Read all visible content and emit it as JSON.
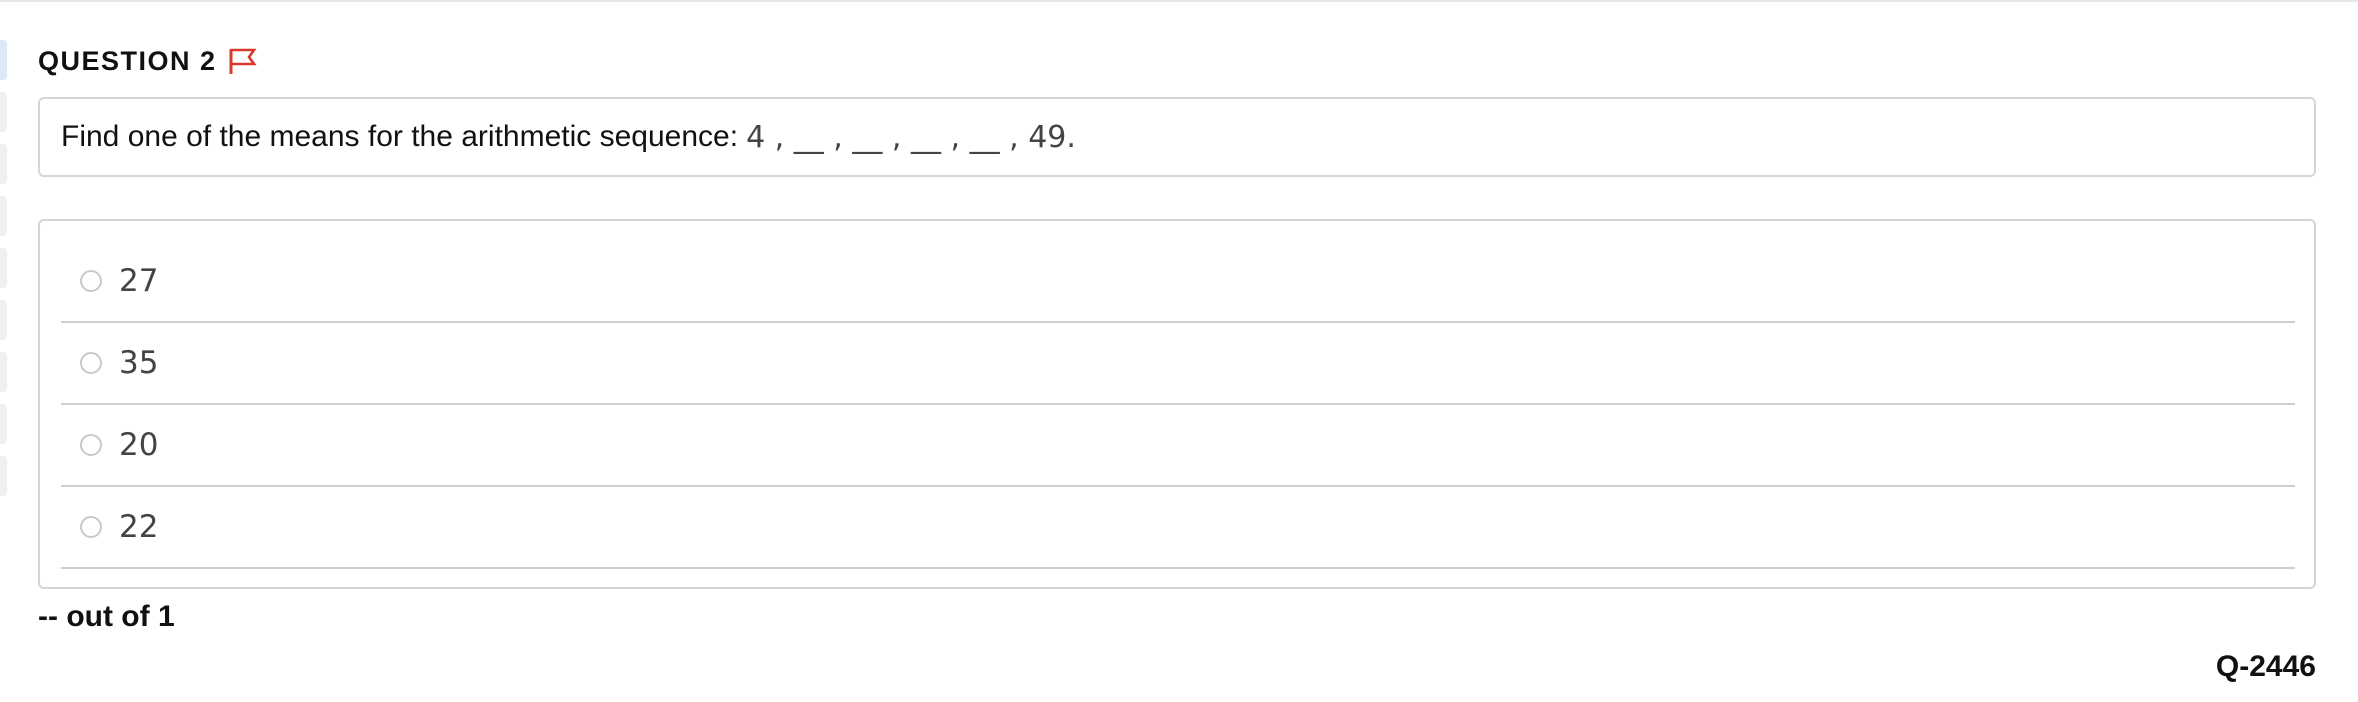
{
  "question": {
    "title": "QUESTION 2",
    "flag_icon": "flag-icon",
    "flag_color": "#d9382c",
    "prompt_text": "Find one of the means for the arithmetic sequence:",
    "prompt_math": "4 , __ , __ , __ , __ , 49."
  },
  "options": [
    {
      "label": "27",
      "selected": false
    },
    {
      "label": "35",
      "selected": false
    },
    {
      "label": "20",
      "selected": false
    },
    {
      "label": "22",
      "selected": false
    }
  ],
  "footer": {
    "score_text": "-- out of 1",
    "question_id": "Q-2446"
  }
}
